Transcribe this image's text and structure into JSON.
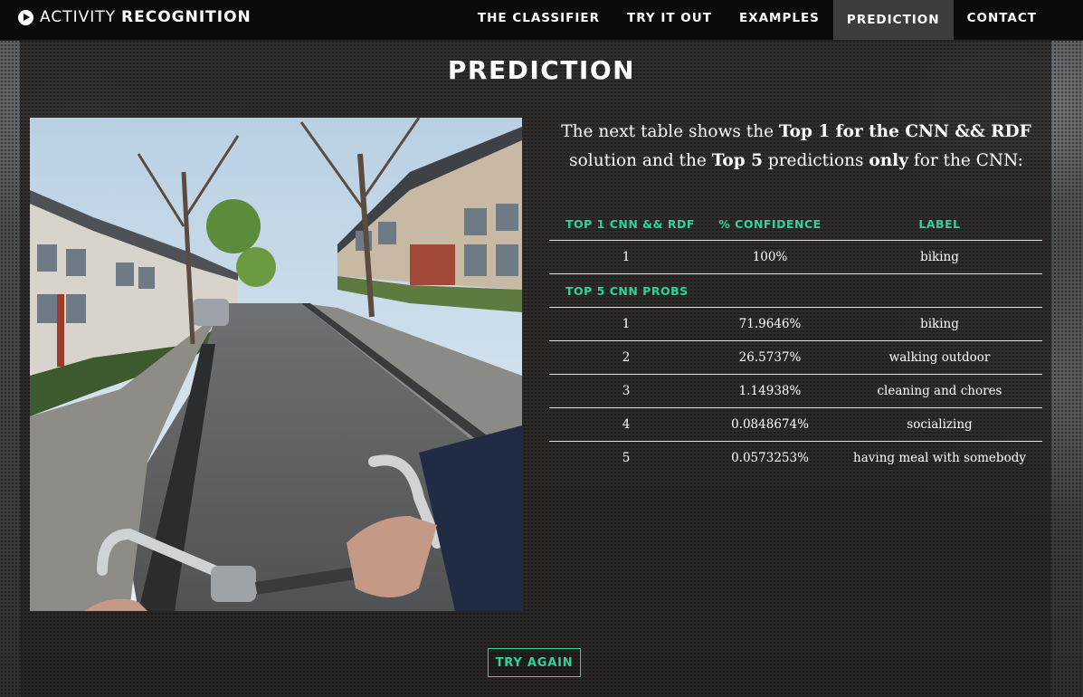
{
  "brand": {
    "light": "ACTIVITY",
    "bold": "RECOGNITION"
  },
  "nav": [
    {
      "label": "THE CLASSIFIER",
      "active": false
    },
    {
      "label": "TRY IT OUT",
      "active": false
    },
    {
      "label": "EXAMPLES",
      "active": false
    },
    {
      "label": "PREDICTION",
      "active": true
    },
    {
      "label": "CONTACT",
      "active": false
    }
  ],
  "page": {
    "title": "PREDICTION"
  },
  "intro": {
    "t1": "The next table shows the ",
    "b1": "Top 1 for the CNN && RDF",
    "t2": " solution and the ",
    "b2": "Top 5",
    "t3": " predictions ",
    "b3": "only",
    "t4": " for the CNN:"
  },
  "table": {
    "headers": [
      "TOP 1 CNN && RDF",
      "% CONFIDENCE",
      "LABEL"
    ],
    "top1": {
      "rank": "1",
      "confidence": "100%",
      "label": "biking"
    },
    "section_label": "TOP 5 CNN PROBS",
    "top5": [
      {
        "rank": "1",
        "confidence": "71.9646%",
        "label": "biking"
      },
      {
        "rank": "2",
        "confidence": "26.5737%",
        "label": "walking outdoor"
      },
      {
        "rank": "3",
        "confidence": "1.14938%",
        "label": "cleaning and chores"
      },
      {
        "rank": "4",
        "confidence": "0.0848674%",
        "label": "socializing"
      },
      {
        "rank": "5",
        "confidence": "0.0573253%",
        "label": "having meal with somebody"
      }
    ]
  },
  "button": {
    "try_again": "TRY AGAIN"
  },
  "colors": {
    "accent": "#2fd29b",
    "navbar": "#0b0b0b",
    "active_tab": "#3d3d3d"
  }
}
